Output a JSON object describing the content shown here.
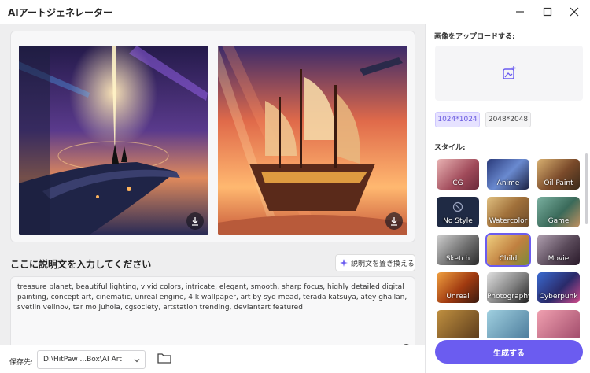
{
  "window": {
    "title": "AIアートジェネレーター"
  },
  "gallery": {
    "images": [
      {
        "name": "treasure-planet-ship-deck"
      },
      {
        "name": "treasure-planet-galleon"
      }
    ]
  },
  "prompt": {
    "title": "ここに説明文を入力してください",
    "replace_label": "説明文を置き換える",
    "text": "treasure planet, beautiful lighting, vivid colors, intricate, elegant, smooth, sharp focus, highly detailed digital painting, concept art, cinematic, unreal engine, 4 k wallpaper, art by syd mead, terada katsuya, atey ghailan, svetlin velinov, tar mo juhola, cgsociety, artstation trending, deviantart featured"
  },
  "save": {
    "label": "保存先:",
    "path": "D:\\HitPaw ...Box\\AI Art"
  },
  "upload": {
    "label": "画像をアップロードする:"
  },
  "sizes": {
    "option1": "1024*1024",
    "option2": "2048*2048"
  },
  "styles": {
    "label": "スタイル:",
    "items": [
      "CG",
      "Anime",
      "Oil Paint",
      "No Style",
      "Watercolor",
      "Game",
      "Sketch",
      "Child",
      "Movie",
      "Unreal",
      "Photography",
      "Cyberpunk"
    ],
    "selected": "Child"
  },
  "generate": {
    "label": "生成する"
  },
  "colors": {
    "accent": "#6b5cf0",
    "selected_size_bg": "#e6e2ff"
  }
}
